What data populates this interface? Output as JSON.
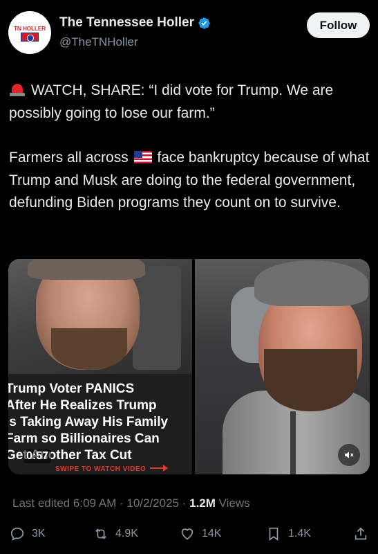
{
  "author": {
    "display_name": "The Tennessee Holler",
    "handle": "@TheTNHoller",
    "avatar_text": "TN HOLLER",
    "verified": true
  },
  "follow_label": "Follow",
  "tweet": {
    "line1": "WATCH, SHARE: “I did vote for Trump. We are possibly going to lose our farm.”",
    "line2_pre": "Farmers all across",
    "line2_post": "face bankruptcy because of what Trump and Musk are doing to the federal government, defunding Biden programs they count on to survive."
  },
  "media": {
    "headline": [
      "Trump Voter PANICS",
      "After He Realizes Trump",
      "Is Taking Away His Family",
      "Farm so Billionaires Can",
      "Get Another Tax Cut"
    ],
    "swipe_text": "SWIPE TO WATCH VIDEO",
    "duration": "0:57"
  },
  "meta": {
    "edited": "Last edited 6:09 AM · 10/2/2025 · ",
    "views_count": "1.2M",
    "views_label": " Views"
  },
  "actions": {
    "replies": "3K",
    "reposts": "4.9K",
    "likes": "14K",
    "bookmarks": "1.4K"
  },
  "colors": {
    "background": "#000000",
    "text": "#e7e9ea",
    "muted": "#71767b",
    "verified": "#1d9bf0",
    "swipe": "#e23b2e"
  }
}
